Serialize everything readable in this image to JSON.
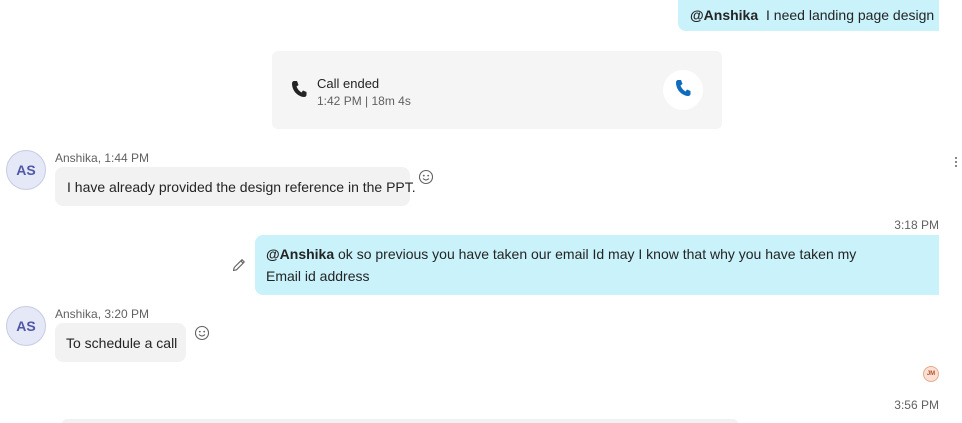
{
  "messages": {
    "out1": {
      "mention": "@Anshika",
      "text": "I need landing page design"
    },
    "call": {
      "title": "Call ended",
      "details": "1:42 PM | 18m 4s"
    },
    "in1": {
      "avatar": "AS",
      "meta": "Anshika, 1:44 PM",
      "text": "I have already provided the design reference in the PPT."
    },
    "out2": {
      "time": "3:18 PM",
      "mention": "@Anshika",
      "text": "ok so previous you have taken our email Id may I know that why you have taken my Email id address"
    },
    "in2": {
      "avatar": "AS",
      "meta": "Anshika, 3:20 PM",
      "text": "To schedule a call"
    },
    "read_receipt": {
      "initials": "JM"
    },
    "next_time": "3:56 PM"
  },
  "colors": {
    "outgoing_bubble": "#c9f2fb",
    "incoming_bubble": "#f2f2f2",
    "accent": "#0f6cbd"
  }
}
